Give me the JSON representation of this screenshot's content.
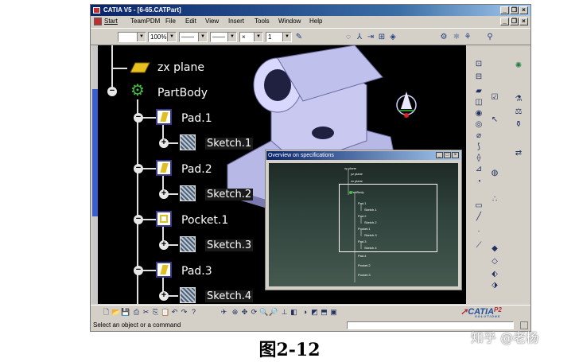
{
  "window": {
    "title": "CATIA V5 - [6-65.CATPart]",
    "controls": {
      "minimize": "_",
      "restore": "❐",
      "close": "×"
    }
  },
  "menu": {
    "items": [
      "Start",
      "TeamPDM",
      "File",
      "Edit",
      "View",
      "Insert",
      "Tools",
      "Window",
      "Help"
    ]
  },
  "toolbar": {
    "color_combo": "",
    "transparency_combo": "100%",
    "linetype_combo": "——",
    "thickness_combo": "——",
    "point_combo": "×",
    "layer_combo": "1"
  },
  "tree": {
    "zx_plane": "zx plane",
    "partbody": "PartBody",
    "pad1": "Pad.1",
    "sketch1": "Sketch.1",
    "pad2": "Pad.2",
    "sketch2": "Sketch.2",
    "pocket1": "Pocket.1",
    "sketch3": "Sketch.3",
    "pad3": "Pad.3",
    "sketch4": "Sketch.4"
  },
  "overview": {
    "title": "Overview on specifications",
    "mini": [
      "xy plane",
      "yz plane",
      "zx plane",
      "PartBody",
      "Pad.1",
      "Sketch.1",
      "Pad.2",
      "Sketch.2",
      "Pocket.1",
      "Sketch.3",
      "Pad.3",
      "Sketch.4",
      "Pad.4",
      "Pocket.2",
      "Pocket.3"
    ]
  },
  "brand": {
    "logo": "CATIA",
    "version": "P2",
    "tagline": "SOLUTIONS"
  },
  "status": {
    "message": "Select an object or a command",
    "command_input": ""
  },
  "figure": {
    "caption": "图2-12",
    "watermark": "知乎 @老杨"
  },
  "colors": {
    "titlebar": "#0a246a",
    "viewport": "#000000",
    "accent": "#e0c020"
  }
}
